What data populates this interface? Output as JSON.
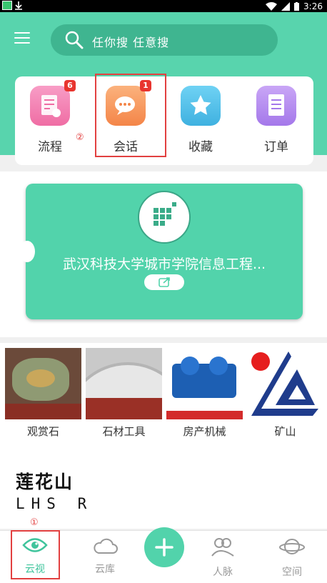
{
  "status_bar": {
    "time": "3:26"
  },
  "search": {
    "placeholder": "任你搜  任意搜"
  },
  "quick_actions": [
    {
      "label": "流程",
      "badge": "6",
      "icon": "document-icon",
      "color": "#f37fb4"
    },
    {
      "label": "会话",
      "badge": "1",
      "icon": "chat-bubble-icon",
      "color": "#f79a5f"
    },
    {
      "label": "收藏",
      "badge": "",
      "icon": "star-icon",
      "color": "#4fc3ea"
    },
    {
      "label": "订单",
      "badge": "",
      "icon": "order-list-icon",
      "color": "#b88ff0"
    }
  ],
  "annotations": {
    "marker_1": "①",
    "marker_2": "②"
  },
  "org_card": {
    "name": "武汉科技大学城市学院信息工程..."
  },
  "products": [
    {
      "name": "观赏石"
    },
    {
      "name": "石材工具"
    },
    {
      "name": "房产机械"
    },
    {
      "name": "矿山"
    }
  ],
  "brand_logo": {
    "cn": "莲花山",
    "en": "LHS R"
  },
  "tabbar": [
    {
      "label": "云视",
      "icon": "eye-icon",
      "active": true
    },
    {
      "label": "云库",
      "icon": "cloud-icon",
      "active": false
    },
    {
      "label": "人脉",
      "icon": "contacts-icon",
      "active": false
    },
    {
      "label": "空间",
      "icon": "planet-icon",
      "active": false
    }
  ],
  "colors": {
    "accent": "#52d3ab",
    "highlight": "#e24040",
    "badge": "#e8352f"
  }
}
